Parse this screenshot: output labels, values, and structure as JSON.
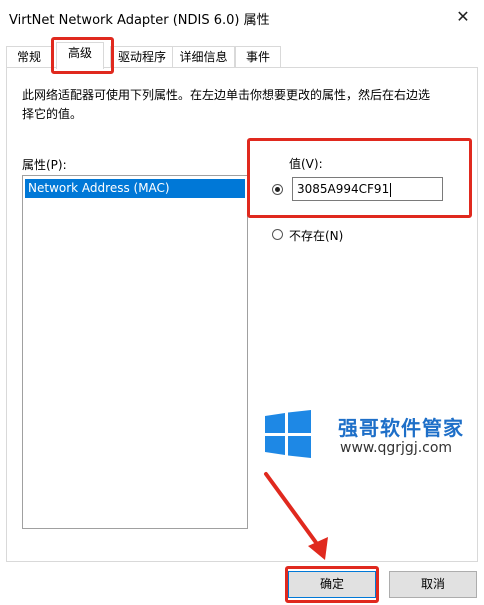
{
  "window": {
    "title": "VirtNet Network Adapter (NDIS 6.0) 属性",
    "close_glyph": "✕"
  },
  "tabs": [
    {
      "label": "常规",
      "active": false
    },
    {
      "label": "高级",
      "active": true
    },
    {
      "label": "驱动程序",
      "active": false
    },
    {
      "label": "详细信息",
      "active": false
    },
    {
      "label": "事件",
      "active": false
    }
  ],
  "advanced": {
    "description": "此网络适配器可使用下列属性。在左边单击你想要更改的属性，然后在右边选择它的值。",
    "property_label": "属性(P):",
    "properties": [
      "Network Address (MAC)"
    ],
    "selected_property": "Network Address (MAC)",
    "value_label": "值(V):",
    "value_radio_selected": true,
    "value": "3085A994CF91",
    "not_present_label": "不存在(N)",
    "not_present_selected": false
  },
  "watermark": {
    "title": "强哥软件管家",
    "url": "www.qgrjgj.com",
    "logo_color": "#1e88e5"
  },
  "buttons": {
    "ok_label": "确定",
    "cancel_label": "取消"
  },
  "annotation_color": "#e0291e"
}
